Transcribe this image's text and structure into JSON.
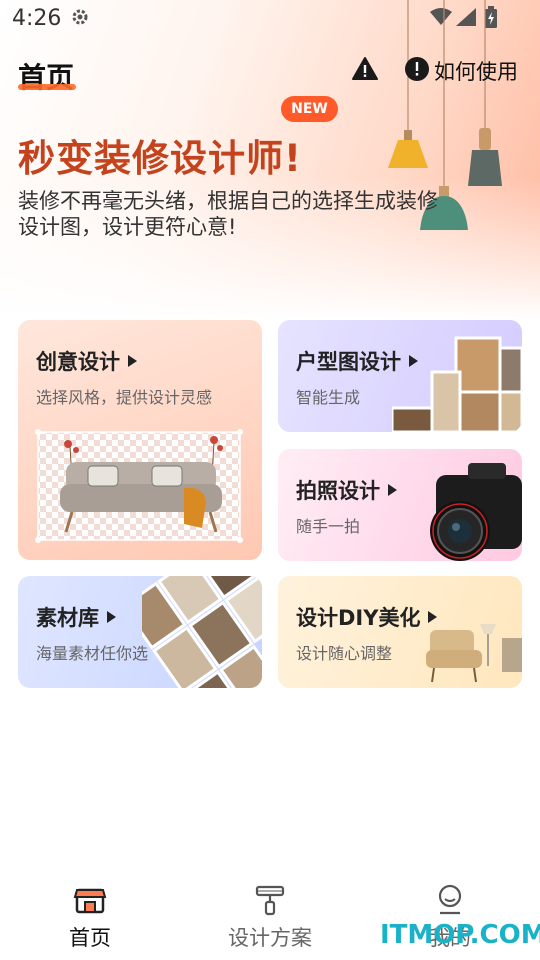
{
  "status_bar": {
    "time": "4:26"
  },
  "header": {
    "title": "首页",
    "help_label": "如何使用"
  },
  "hero": {
    "badge": "NEW",
    "title": "秒变装修设计师!",
    "subtitle": "装修不再毫无头绪，根据自己的选择生成装修设计图，设计更符心意!"
  },
  "cards": [
    {
      "title": "创意设计",
      "subtitle": "选择风格，提供设计灵感"
    },
    {
      "title": "户型图设计",
      "subtitle": "智能生成"
    },
    {
      "title": "拍照设计",
      "subtitle": "随手一拍"
    },
    {
      "title": "素材库",
      "subtitle": "海量素材任你选"
    },
    {
      "title": "设计DIY美化",
      "subtitle": "设计随心调整"
    }
  ],
  "bottom_nav": [
    {
      "label": "首页",
      "icon": "store-icon",
      "active": true
    },
    {
      "label": "设计方案",
      "icon": "paint-roller-icon",
      "active": false
    },
    {
      "label": "我的",
      "icon": "profile-icon",
      "active": false
    }
  ],
  "watermark": "ITMOP.COM",
  "colors": {
    "accent": "#ff5a2a",
    "hero_title": "#c4421c",
    "watermark": "#1ab2c8"
  }
}
